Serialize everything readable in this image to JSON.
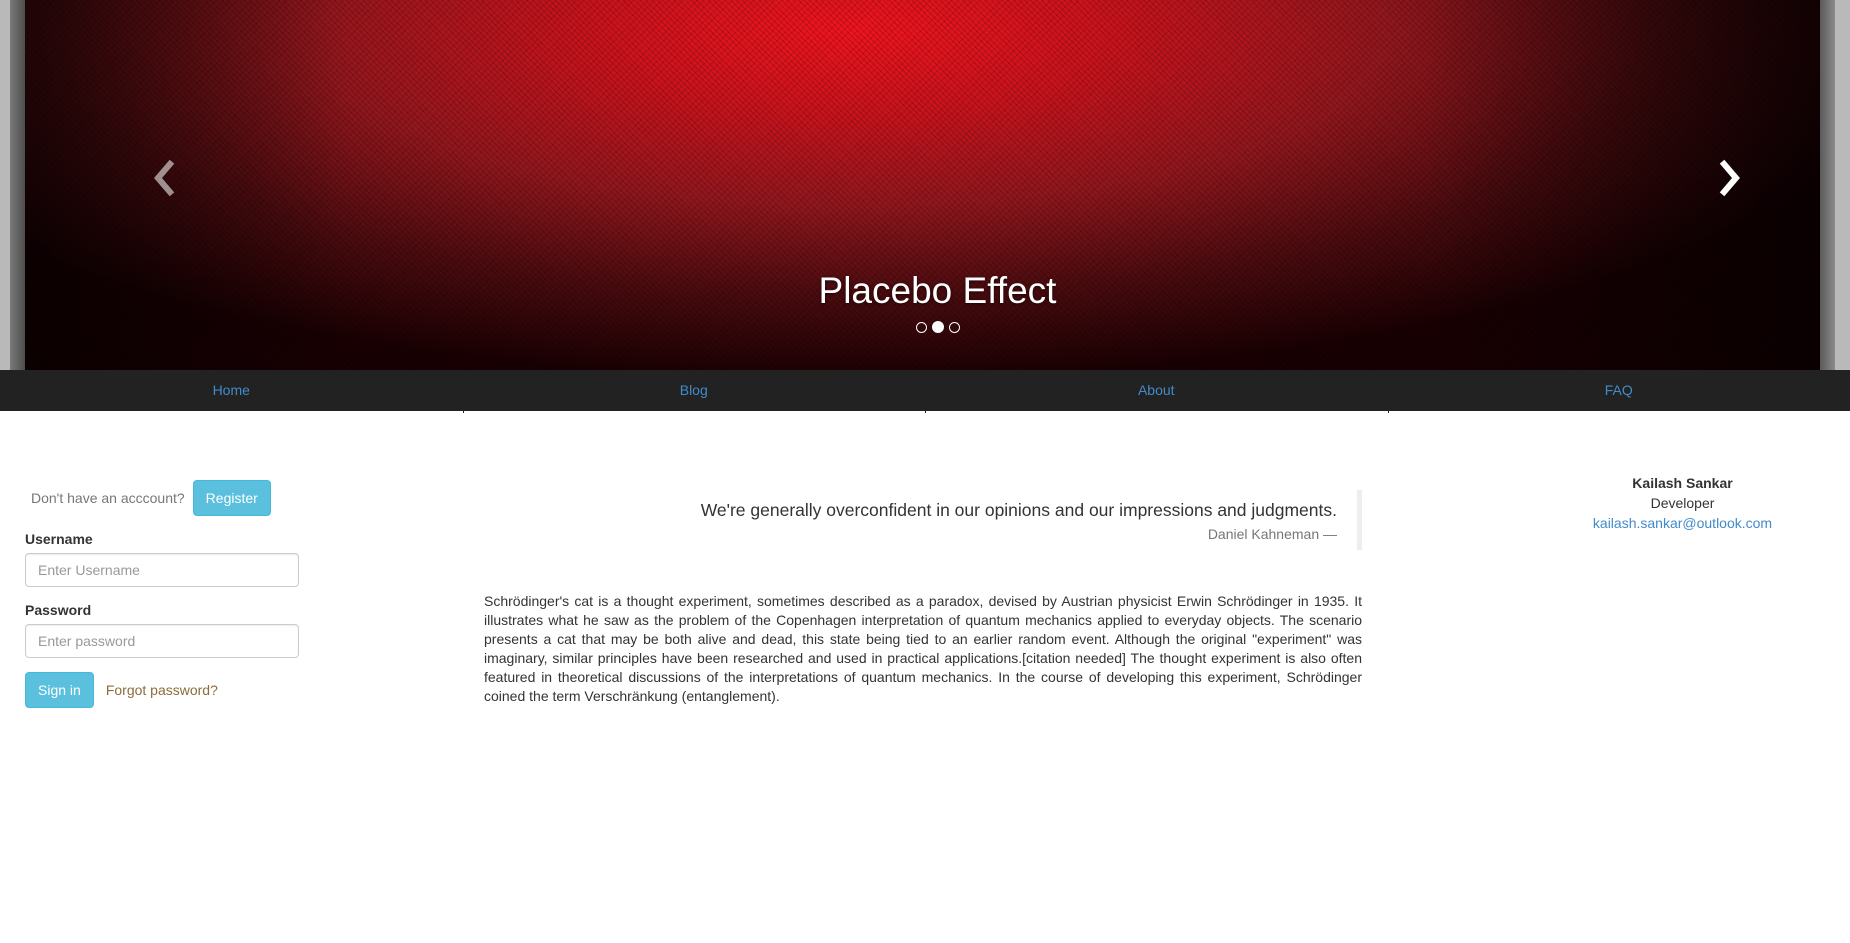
{
  "carousel": {
    "caption": "Placebo Effect",
    "indicators": [
      {
        "active": false
      },
      {
        "active": true
      },
      {
        "active": false
      }
    ],
    "prev_icon": "chevron-left-icon",
    "next_icon": "chevron-right-icon"
  },
  "nav": {
    "items": [
      {
        "label": "Home"
      },
      {
        "label": "Blog"
      },
      {
        "label": "About"
      },
      {
        "label": "FAQ"
      }
    ],
    "link_color": "#428bca",
    "bg_color": "#222222"
  },
  "login": {
    "register_prompt": "Don't have an acccount?",
    "register_label": "Register",
    "username_label": "Username",
    "username_placeholder": "Enter Username",
    "password_label": "Password",
    "password_placeholder": "Enter password",
    "signin_label": "Sign in",
    "forgot_label": "Forgot password?"
  },
  "quote": {
    "text": "We're generally overconfident in our opinions and our impressions and judgments.",
    "author": "Daniel Kahneman —"
  },
  "article": {
    "text": "Schrödinger's cat is a thought experiment, sometimes described as a paradox, devised by Austrian physicist Erwin Schrödinger in 1935. It illustrates what he saw as the problem of the Copenhagen interpretation of quantum mechanics applied to everyday objects. The scenario presents a cat that may be both alive and dead, this state being tied to an earlier random event. Although the original \"experiment\" was imaginary, similar principles have been researched and used in practical applications.[citation needed] The thought experiment is also often featured in theoretical discussions of the interpretations of quantum mechanics. In the course of developing this experiment, Schrödinger coined the term Verschränkung (entanglement)."
  },
  "developer": {
    "name": "Kailash Sankar",
    "role": "Developer",
    "email": "kailash.sankar@outlook.com"
  },
  "colors": {
    "info_button": "#5bc0de",
    "forgot_link": "#8a6d3b"
  }
}
